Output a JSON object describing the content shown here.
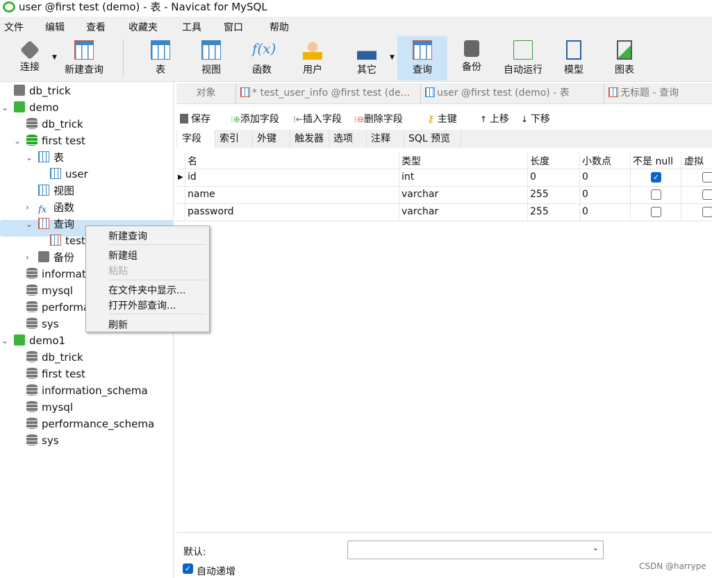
{
  "window": {
    "title": "user @first test (demo) - 表 - Navicat for MySQL"
  },
  "menu": [
    "文件",
    "编辑",
    "查看",
    "收藏夹",
    "工具",
    "窗口",
    "帮助"
  ],
  "toolbar": {
    "items": [
      {
        "label": "连接",
        "icon": "plug-icon"
      },
      {
        "label": "新建查询",
        "icon": "new-query-icon"
      },
      {
        "label": "表",
        "icon": "table-icon"
      },
      {
        "label": "视图",
        "icon": "view-icon"
      },
      {
        "label": "函数",
        "icon": "function-icon"
      },
      {
        "label": "用户",
        "icon": "user-icon"
      },
      {
        "label": "其它",
        "icon": "tools-icon"
      },
      {
        "label": "查询",
        "icon": "query-icon",
        "selected": true
      },
      {
        "label": "备份",
        "icon": "backup-icon"
      },
      {
        "label": "自动运行",
        "icon": "schedule-icon"
      },
      {
        "label": "模型",
        "icon": "model-icon"
      },
      {
        "label": "图表",
        "icon": "chart-icon"
      }
    ],
    "fx": "f(x)"
  },
  "sidebar": {
    "tree": [
      "db_trick",
      "demo",
      "db_trick",
      "first test",
      "表",
      "user",
      "视图",
      "函数",
      "查询",
      "test_",
      "备份",
      "informat",
      "mysql",
      "performa",
      "sys",
      "demo1",
      "db_trick",
      "first test",
      "information_schema",
      "mysql",
      "performance_schema",
      "sys"
    ]
  },
  "context_menu": {
    "items": [
      "新建查询",
      "新建组",
      "粘贴",
      "在文件夹中显示...",
      "打开外部查询...",
      "刷新"
    ],
    "disabled": [
      "粘贴"
    ]
  },
  "tabs": [
    "对象",
    "* test_user_info @first test (de...",
    "user @first test (demo) - 表",
    "无标题 - 查询"
  ],
  "editor_toolbar": [
    "保存",
    "添加字段",
    "插入字段",
    "删除字段",
    "主键",
    "上移",
    "下移"
  ],
  "subtabs": [
    "字段",
    "索引",
    "外键",
    "触发器",
    "选项",
    "注释",
    "SQL 预览"
  ],
  "fields": {
    "columns": [
      "名",
      "类型",
      "长度",
      "小数点",
      "不是 null",
      "虚拟"
    ],
    "rows": [
      {
        "name": "id",
        "type": "int",
        "length": "0",
        "decimals": "0",
        "not_null": true,
        "virtual": false
      },
      {
        "name": "name",
        "type": "varchar",
        "length": "255",
        "decimals": "0",
        "not_null": false,
        "virtual": false
      },
      {
        "name": "password",
        "type": "varchar",
        "length": "255",
        "decimals": "0",
        "not_null": false,
        "virtual": false
      }
    ]
  },
  "bottom": {
    "default_label": "默认:",
    "default_value": "",
    "auto_increment_label": "自动递增",
    "auto_increment": true
  },
  "watermark": "CSDN @harrype",
  "colors": {
    "accent": "#0a63c9",
    "selection": "#cce4f7"
  }
}
